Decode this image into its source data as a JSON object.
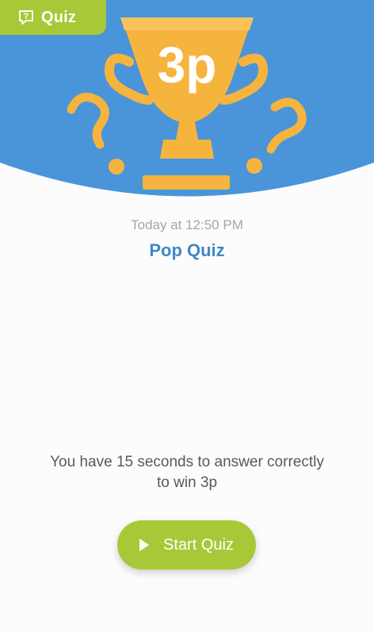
{
  "tag": {
    "label": "Quiz",
    "icon": "speech-bubble-question-icon"
  },
  "trophy": {
    "amount": "3p",
    "icon": "trophy-icon"
  },
  "timestamp": "Today at 12:50 PM",
  "title": "Pop Quiz",
  "message": "You have 15 seconds to answer correctly to win 3p",
  "start_button": {
    "label": "Start Quiz",
    "icon": "play-icon"
  },
  "colors": {
    "header_blue": "#4a95d9",
    "accent_green": "#a7c938",
    "trophy_gold": "#f5b43e",
    "title_blue": "#3f88c5"
  }
}
